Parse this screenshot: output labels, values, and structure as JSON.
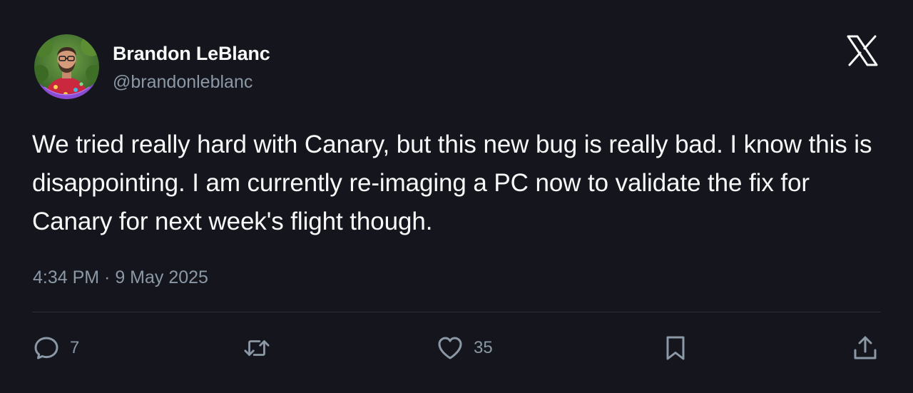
{
  "author": {
    "display_name": "Brandon LeBlanc",
    "handle": "@brandonleblanc",
    "avatar_icon": "profile-photo"
  },
  "brand": {
    "logo_icon": "x-logo-icon"
  },
  "tweet": {
    "text": "We tried really hard with Canary, but this new bug is really bad. I know this is disappointing. I am currently re-imaging a PC now to validate the fix for Canary for next week's flight though.",
    "timestamp": "4:34 PM · 9 May 2025"
  },
  "actions": {
    "reply": {
      "icon": "reply-icon",
      "count": "7"
    },
    "retweet": {
      "icon": "retweet-icon",
      "count": ""
    },
    "like": {
      "icon": "heart-icon",
      "count": "35"
    },
    "bookmark": {
      "icon": "bookmark-icon"
    },
    "share": {
      "icon": "share-icon"
    }
  },
  "colors": {
    "background": "#15151d",
    "text_primary": "#f7f9f9",
    "text_secondary": "#8b98a5",
    "divider": "#2c2f36"
  }
}
